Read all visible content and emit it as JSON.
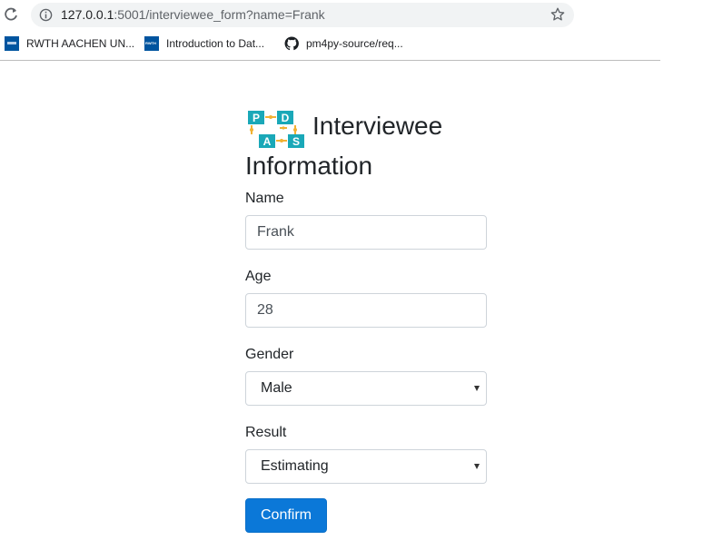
{
  "browser": {
    "url_host": "127.0.0.1",
    "url_rest": ":5001/interviewee_form?name=Frank",
    "bookmarks": [
      {
        "label": "RWTH AACHEN UN...",
        "icon": "rwth-logo-icon"
      },
      {
        "label": "Introduction to Dat...",
        "icon": "rwth-logo-icon"
      },
      {
        "label": "pm4py-source/req...",
        "icon": "github-icon"
      }
    ]
  },
  "page": {
    "title_line1": "Interviewee",
    "title_line2": "Information",
    "logo_letters": [
      "P",
      "D",
      "A",
      "S"
    ]
  },
  "form": {
    "name_label": "Name",
    "name_value": "Frank",
    "age_label": "Age",
    "age_value": "28",
    "gender_label": "Gender",
    "gender_value": "Male",
    "result_label": "Result",
    "result_value": "Estimating",
    "confirm_label": "Confirm"
  },
  "colors": {
    "button": "#0b78d8",
    "logo_teal": "#1aa8b8",
    "logo_yellow": "#f2b233"
  }
}
